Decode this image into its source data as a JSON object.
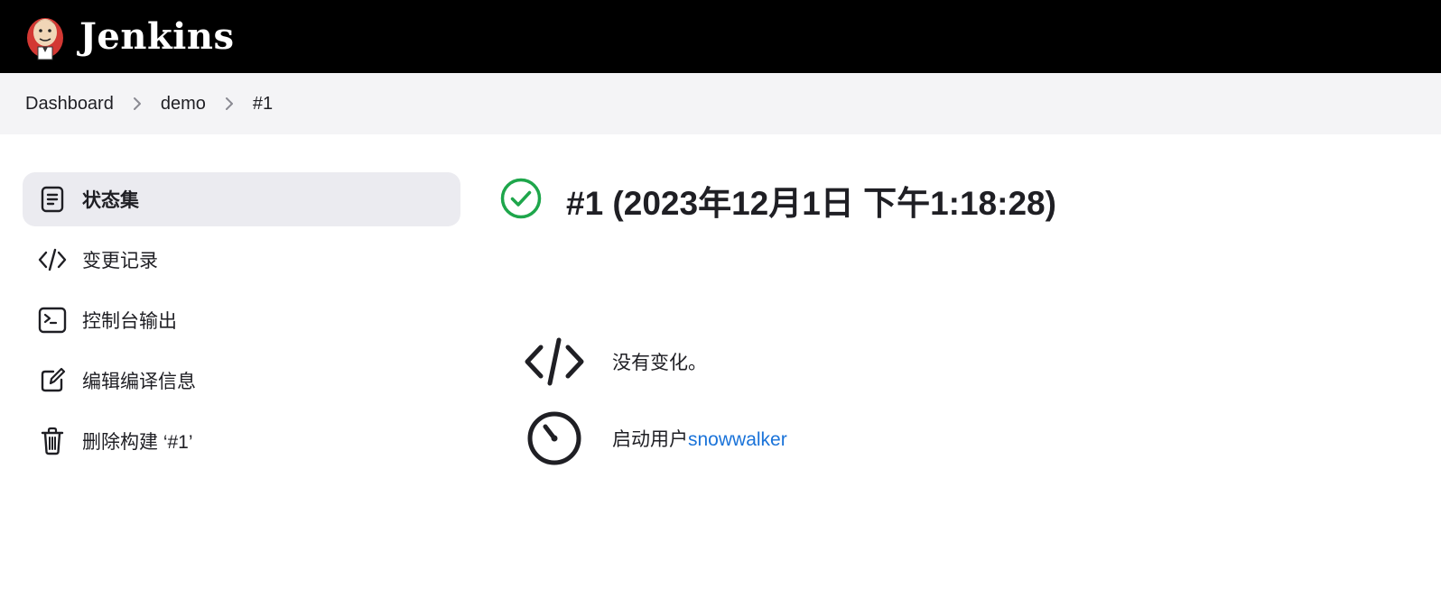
{
  "header": {
    "brand": "Jenkins",
    "logo_icon": "jenkins-butler-logo"
  },
  "breadcrumb": {
    "items": [
      "Dashboard",
      "demo",
      "#1"
    ]
  },
  "sidebar": {
    "items": [
      {
        "label": "状态集",
        "icon": "document-icon",
        "active": true
      },
      {
        "label": "变更记录",
        "icon": "code-icon",
        "active": false
      },
      {
        "label": "控制台输出",
        "icon": "terminal-icon",
        "active": false
      },
      {
        "label": "编辑编译信息",
        "icon": "edit-icon",
        "active": false
      },
      {
        "label": "删除构建 ‘#1’",
        "icon": "trash-icon",
        "active": false
      }
    ]
  },
  "main": {
    "status_icon": "success-check-icon",
    "title": "#1 (2023年12月1日 下午1:18:28)",
    "changes_text": "没有变化。",
    "started_by_prefix": "启动用户",
    "started_by_user": "snowwalker"
  },
  "colors": {
    "header_bg": "#000000",
    "breadcrumb_bg": "#f4f4f6",
    "active_item_bg": "#ebebf0",
    "success_green": "#1ea64b",
    "link_blue": "#1a73d9"
  }
}
